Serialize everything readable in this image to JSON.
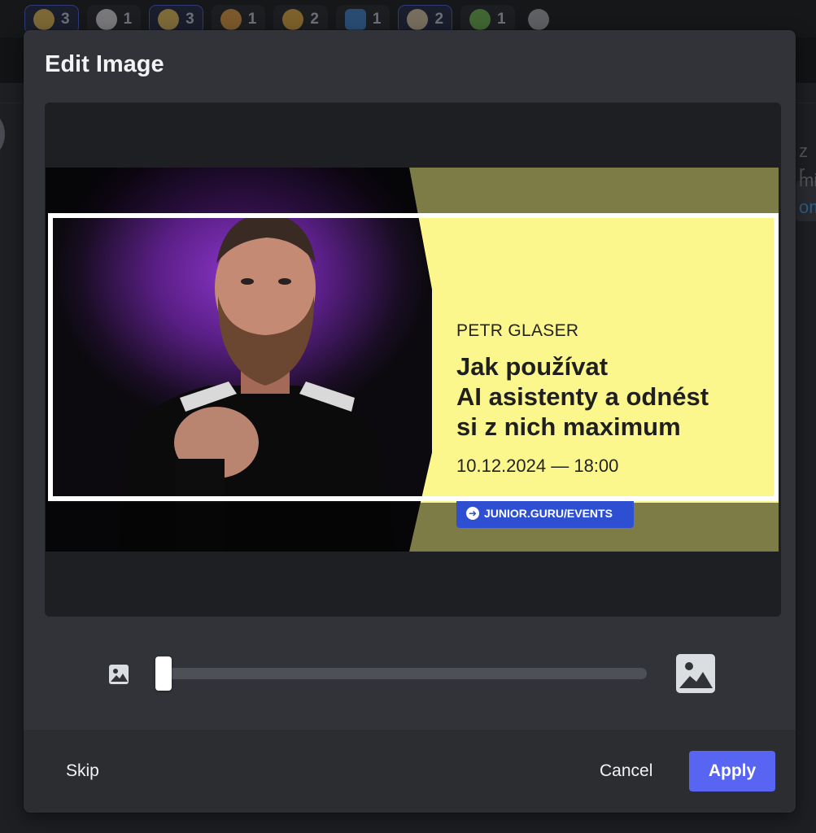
{
  "reactions": [
    {
      "emoji": "sparkles",
      "count": "3",
      "active": true
    },
    {
      "emoji": "eyes",
      "count": "1",
      "active": false
    },
    {
      "emoji": "star-struck",
      "count": "3",
      "active": true
    },
    {
      "emoji": "heart-eyes",
      "count": "1",
      "active": false
    },
    {
      "emoji": "thumbs-up",
      "count": "2",
      "active": false
    },
    {
      "emoji": "blue-square",
      "count": "1",
      "active": false
    },
    {
      "emoji": "popcorn",
      "count": "2",
      "active": true
    },
    {
      "emoji": "frog",
      "count": "1",
      "active": false
    }
  ],
  "background": {
    "snippet1": "z r",
    "snippet2": "mi",
    "snippet3": "om"
  },
  "modal": {
    "title": "Edit Image",
    "banner": {
      "speaker": "PETR GLASER",
      "title_lines": [
        "Jak používat",
        "AI asistenty a odnést",
        "si z nich maximum"
      ],
      "datetime": "10.12.2024 — 18:00",
      "url_label": "JUNIOR.GURU/EVENTS"
    },
    "zoom": {
      "min_icon": "image-small-icon",
      "max_icon": "image-large-icon",
      "value": 0.0
    },
    "footer": {
      "skip_label": "Skip",
      "cancel_label": "Cancel",
      "apply_label": "Apply"
    }
  },
  "colors": {
    "accent": "#5865f2",
    "modal_bg": "#313338",
    "banner_yellow": "#fbf78c",
    "banner_link": "#2e4fd1"
  }
}
